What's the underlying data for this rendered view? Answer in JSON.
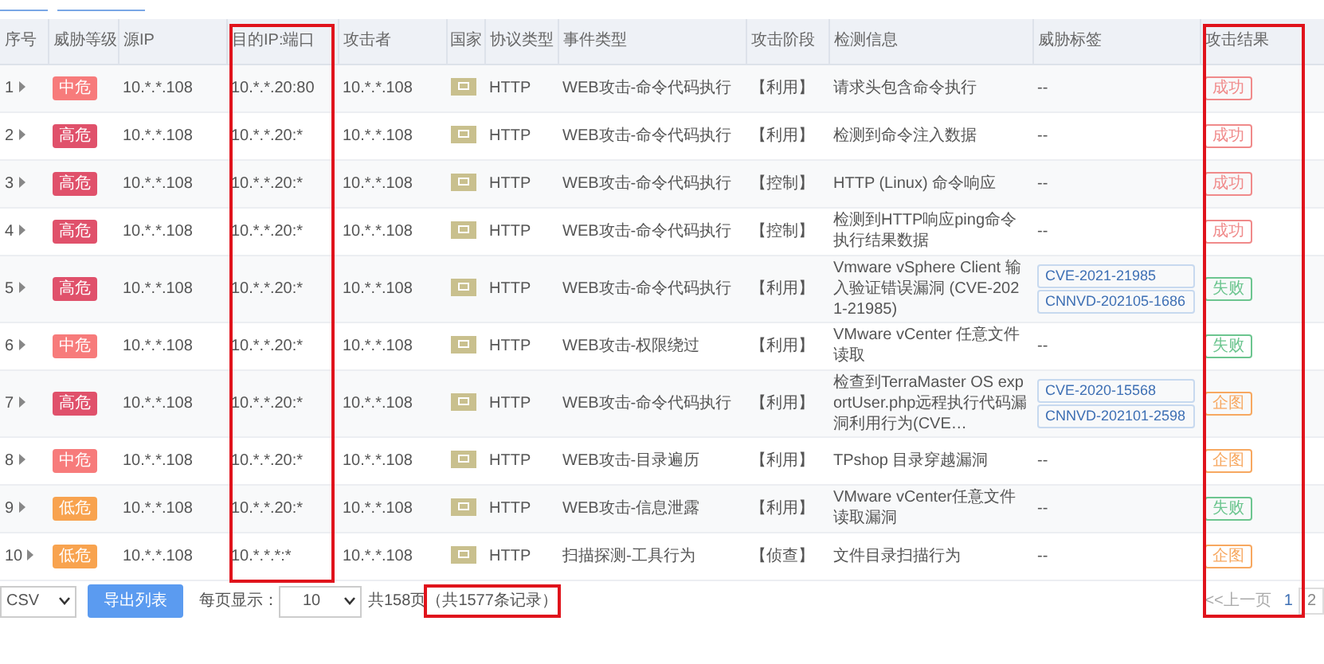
{
  "columns": [
    {
      "label": "序号",
      "boxed": false
    },
    {
      "label": "威胁等级",
      "boxed": false
    },
    {
      "label": "源IP",
      "boxed": false
    },
    {
      "label": "目的IP:端口",
      "boxed": true
    },
    {
      "label": "攻击者",
      "boxed": false
    },
    {
      "label": "国家",
      "boxed": false
    },
    {
      "label": "协议类型",
      "boxed": false
    },
    {
      "label": "事件类型",
      "boxed": false
    },
    {
      "label": "攻击阶段",
      "boxed": false
    },
    {
      "label": "检测信息",
      "boxed": false
    },
    {
      "label": "威胁标签",
      "boxed": false
    },
    {
      "label": "攻击结果",
      "boxed": true
    }
  ],
  "rows": [
    {
      "no": "1",
      "level": {
        "text": "中危",
        "kind": "medium"
      },
      "src": "10.*.*.108",
      "dst": "10.*.*.20:80",
      "attacker": "10.*.*.108",
      "protocol": "HTTP",
      "event": "WEB攻击-命令代码执行",
      "stage": "【利用】",
      "detect": "请求头包含命令执行",
      "tag_text": "--",
      "result": {
        "text": "成功",
        "kind": "success"
      }
    },
    {
      "no": "2",
      "level": {
        "text": "高危",
        "kind": "high"
      },
      "src": "10.*.*.108",
      "dst": "10.*.*.20:*",
      "attacker": "10.*.*.108",
      "protocol": "HTTP",
      "event": "WEB攻击-命令代码执行",
      "stage": "【利用】",
      "detect": "检测到命令注入数据",
      "tag_text": "--",
      "result": {
        "text": "成功",
        "kind": "success"
      }
    },
    {
      "no": "3",
      "level": {
        "text": "高危",
        "kind": "high"
      },
      "src": "10.*.*.108",
      "dst": "10.*.*.20:*",
      "attacker": "10.*.*.108",
      "protocol": "HTTP",
      "event": "WEB攻击-命令代码执行",
      "stage": "【控制】",
      "detect": "HTTP (Linux) 命令响应",
      "tag_text": "--",
      "result": {
        "text": "成功",
        "kind": "success"
      }
    },
    {
      "no": "4",
      "level": {
        "text": "高危",
        "kind": "high"
      },
      "src": "10.*.*.108",
      "dst": "10.*.*.20:*",
      "attacker": "10.*.*.108",
      "protocol": "HTTP",
      "event": "WEB攻击-命令代码执行",
      "stage": "【控制】",
      "detect": "检测到HTTP响应ping命令执行结果数据",
      "tag_text": "--",
      "result": {
        "text": "成功",
        "kind": "success"
      }
    },
    {
      "no": "5",
      "level": {
        "text": "高危",
        "kind": "high"
      },
      "src": "10.*.*.108",
      "dst": "10.*.*.20:*",
      "attacker": "10.*.*.108",
      "protocol": "HTTP",
      "event": "WEB攻击-命令代码执行",
      "stage": "【利用】",
      "detect": "Vmware vSphere Client 输入验证错误漏洞 (CVE-2021-21985)",
      "tags": [
        "CVE-2021-21985",
        "CNNVD-202105-1686"
      ],
      "result": {
        "text": "失败",
        "kind": "fail"
      }
    },
    {
      "no": "6",
      "level": {
        "text": "中危",
        "kind": "medium"
      },
      "src": "10.*.*.108",
      "dst": "10.*.*.20:*",
      "attacker": "10.*.*.108",
      "protocol": "HTTP",
      "event": "WEB攻击-权限绕过",
      "stage": "【利用】",
      "detect": "VMware vCenter 任意文件读取",
      "tag_text": "--",
      "result": {
        "text": "失败",
        "kind": "fail"
      }
    },
    {
      "no": "7",
      "level": {
        "text": "高危",
        "kind": "high"
      },
      "src": "10.*.*.108",
      "dst": "10.*.*.20:*",
      "attacker": "10.*.*.108",
      "protocol": "HTTP",
      "event": "WEB攻击-命令代码执行",
      "stage": "【利用】",
      "detect": "检查到TerraMaster OS exportUser.php远程执行代码漏洞利用行为(CVE…",
      "tags": [
        "CVE-2020-15568",
        "CNNVD-202101-2598"
      ],
      "result": {
        "text": "企图",
        "kind": "attempt"
      }
    },
    {
      "no": "8",
      "level": {
        "text": "中危",
        "kind": "medium"
      },
      "src": "10.*.*.108",
      "dst": "10.*.*.20:*",
      "attacker": "10.*.*.108",
      "protocol": "HTTP",
      "event": "WEB攻击-目录遍历",
      "stage": "【利用】",
      "detect": "TPshop 目录穿越漏洞",
      "tag_text": "--",
      "result": {
        "text": "企图",
        "kind": "attempt"
      }
    },
    {
      "no": "9",
      "level": {
        "text": "低危",
        "kind": "low"
      },
      "src": "10.*.*.108",
      "dst": "10.*.*.20:*",
      "attacker": "10.*.*.108",
      "protocol": "HTTP",
      "event": "WEB攻击-信息泄露",
      "stage": "【利用】",
      "detect": "VMware vCenter任意文件读取漏洞",
      "tag_text": "--",
      "result": {
        "text": "失败",
        "kind": "fail"
      }
    },
    {
      "no": "10",
      "level": {
        "text": "低危",
        "kind": "low"
      },
      "src": "10.*.*.108",
      "dst": "10.*.*.*:*",
      "attacker": "10.*.*.108",
      "protocol": "HTTP",
      "event": "扫描探测-工具行为",
      "stage": "【侦查】",
      "detect": "文件目录扫描行为",
      "tag_text": "--",
      "result": {
        "text": "企图",
        "kind": "attempt"
      }
    }
  ],
  "footer": {
    "export_format": "CSV",
    "export_button": "导出列表",
    "page_size_label": "每页显示：",
    "page_size": "10",
    "pages": "共158页",
    "records": "（共1577条记录）",
    "records_boxed": true,
    "prev": "<<上一页",
    "page_links": [
      {
        "label": "1",
        "selected": true
      },
      {
        "label": "2",
        "selected": false
      }
    ]
  }
}
